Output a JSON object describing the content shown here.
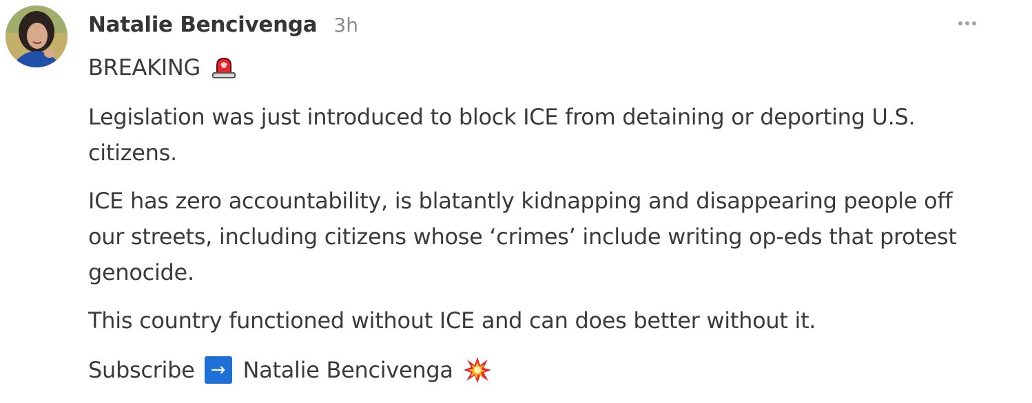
{
  "post": {
    "author": "Natalie Bencivenga",
    "time": "3h",
    "breaking": "BREAKING",
    "paragraphs": [
      "Legislation was just introduced to block ICE from detaining or deporting U.S. citizens.",
      "ICE has zero accountability, is blatantly kidnapping and disappearing people off our streets, including citizens whose ‘crimes’ include writing op-eds that protest genocide.",
      "This country functioned without ICE and can does better without it."
    ],
    "subscribe": {
      "label": "Subscribe",
      "arrow": "→",
      "name": "Natalie Bencivenga"
    }
  },
  "icons": {
    "breaking": "police-light-icon",
    "subscribe_arrow": "right-arrow-icon",
    "burst": "collision-icon",
    "menu": "more-options-icon"
  },
  "colors": {
    "author_text": "#363636",
    "body_text": "#3a3a3a",
    "time_text": "#8a8a8a",
    "arrow_box": "#1e6fd6",
    "siren_red": "#e5252b"
  }
}
